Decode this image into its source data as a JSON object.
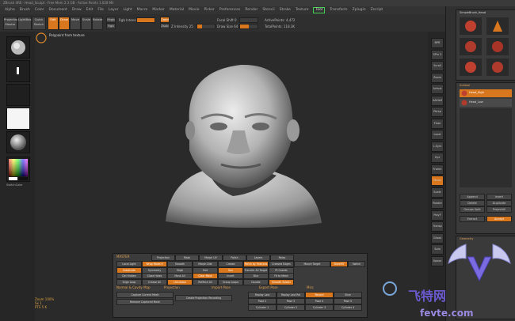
{
  "window": {
    "title": "ZBrush 4R6  ·  Head_Sculpt  ·  Free Mem 2.3 GB  ·  Active Points 1.028 Mil"
  },
  "menu": {
    "items": [
      "Alpha",
      "Brush",
      "Color",
      "Document",
      "Draw",
      "Edit",
      "File",
      "Layer",
      "Light",
      "Macro",
      "Marker",
      "Material",
      "Movie",
      "Picker",
      "Preferences",
      "Render",
      "Stencil",
      "Stroke",
      "Texture",
      "Tool",
      "Transform",
      "Zplugin",
      "Zscript"
    ],
    "active": "Tool",
    "right_items": [
      "Menus",
      "DefaultZScript"
    ]
  },
  "topbar": {
    "projection_label": "Projection Master",
    "lightbox_label": "LightBox",
    "quicksketch_label": "Quick Sketch",
    "edit_label": "Edit",
    "draw_label": "Draw",
    "move_label": "Move",
    "scale_label": "Scale",
    "rotate_label": "Rotate",
    "mrgb_label": "Mrgb",
    "rgb_label": "Rgb",
    "m_label": "M",
    "zadd_label": "Zadd",
    "zsub_label": "Zsub",
    "zcut_label": "Zcut",
    "focal_shift_label": "Focal Shift 0",
    "draw_size_label": "Draw Size 64",
    "rgb_intensity_label": "Rgb Intensity 100",
    "z_intensity_label": "Z Intensity 25",
    "active_points_label": "ActivePoints: 4,472",
    "total_points_label": "TotalPoints: 118.3K",
    "focal_fill": 0.0,
    "drawsize_fill": 0.5,
    "rgb_fill": 1.0,
    "zint_fill": 0.25
  },
  "canvas": {
    "info_line": "Polypaint from texture"
  },
  "left_tray": {
    "brush_label": "Standard",
    "stroke_label": "Dots",
    "alpha_label": "Alpha Off",
    "texture_label": "Texture Off",
    "material_label": "MatCap Gray",
    "color_label": "Gradient",
    "switch_color_label": "SwitchColor"
  },
  "right_shelf": {
    "buttons": [
      "BPR",
      "SPix 3",
      "Scroll",
      "Zoom",
      "Actual",
      "AAHalf",
      "Persp",
      "Floor",
      "Local",
      "L.Sym",
      "Xyz",
      "Frame",
      "Move",
      "Scale",
      "Rotate",
      "PolyF",
      "Transp",
      "Ghost",
      "Solo",
      "Xpose"
    ]
  },
  "right_tray": {
    "tool_header": "SimpleBrush_Head",
    "subtool_header": "Subtool",
    "subtools": [
      "Head_High",
      "Head_Low"
    ],
    "buttons": {
      "append": "Append",
      "insert": "Insert",
      "delete": "Delete",
      "duplicate": "Duplicate",
      "groups_split": "Groups Split",
      "project_all": "ProjectAll",
      "extract": "Extract",
      "accept": "Accept"
    },
    "geometry_header": "Geometry"
  },
  "bottom_panel": {
    "title": "MASTER",
    "tabs": [
      "Projection",
      "Mask",
      "Morph UV",
      "Polish",
      "Layers",
      "Relax"
    ],
    "rows": [
      [
        "Local Light",
        "Wrap Mode 0",
        "Smooth",
        "Morph Dist",
        "Crease",
        "Polish by Features",
        "Creased Edges"
      ],
      [
        "Subdivide",
        "Symmetry",
        "Mrgb",
        "Smt",
        "Suv",
        "Transfer All Target",
        "Pt Coords"
      ],
      [
        "Del Hidden",
        "Close Holes",
        "Mask All",
        "Clear Mask",
        "Invert",
        "Blur",
        "Fit to Mesh"
      ],
      [
        "Edge Loop",
        "Crease All",
        "UnCrease",
        "ReMesh All",
        "Group Loops",
        "Double",
        "Smooth Subdiv"
      ]
    ],
    "morph_label": "Morph Target",
    "store_mt": "StoreMT",
    "switch": "Switch",
    "deform_header": "Deformation",
    "capture_label": "Capture Current Mesh",
    "remove_label": "Remove Captured Mesh",
    "project_history": "Create Projection Recording",
    "sections": [
      "Normal & Cavity Map",
      "Projection",
      "Import Pose",
      "Export Pose",
      "Misc"
    ],
    "projection_rows": [
      [
        "Replay Last",
        "Replay Last Rel",
        "Record",
        "Slice"
      ],
      [
        "Pose 2",
        "Pose 3",
        "Pose 4",
        "Pose 5"
      ],
      [
        "Cylinder 1",
        "Cylinder 2",
        "Cylinder 3",
        "Cylinder 4"
      ]
    ]
  },
  "statusline": {
    "lines": [
      "Zoom 100%",
      "Sx 1",
      "PTS 5 K"
    ]
  },
  "watermark": {
    "site_cn": "飞特网",
    "site_en": "fevte.com"
  },
  "colors": {
    "accent": "#d9771f",
    "highlight_green": "#3fd14f",
    "panel": "#3b3b3b",
    "background": "#2a2a2a"
  }
}
